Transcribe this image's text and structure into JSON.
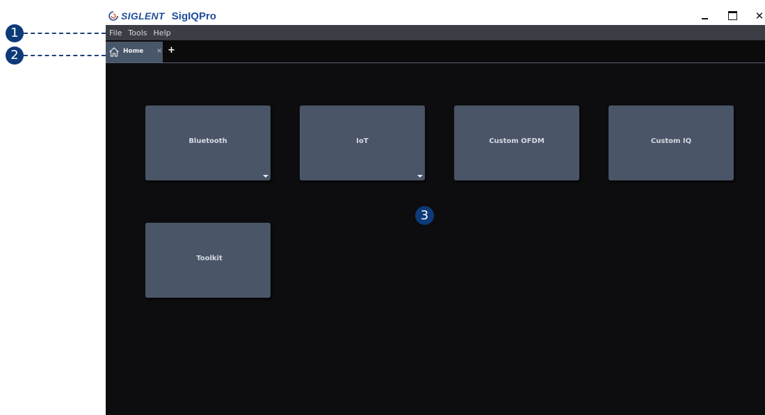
{
  "callouts": [
    "1",
    "2",
    "3"
  ],
  "app": {
    "brand": "SIGLENT",
    "title": "SigIQPro"
  },
  "window_controls": {
    "minimize": "_",
    "maximize": "☐",
    "close": "✕"
  },
  "menu": [
    "File",
    "Tools",
    "Help"
  ],
  "tabs": [
    {
      "label": "Home",
      "icon": "home-icon",
      "close": "×"
    }
  ],
  "tab_add": "+",
  "tiles": [
    {
      "label": "Bluetooth",
      "has_dropdown": true
    },
    {
      "label": "IoT",
      "has_dropdown": true
    },
    {
      "label": "Custom OFDM",
      "has_dropdown": false
    },
    {
      "label": "Custom IQ",
      "has_dropdown": false
    },
    {
      "label": "Toolkit",
      "has_dropdown": false
    }
  ],
  "colors": {
    "callout": "#0d3a78",
    "brand": "#1f4e9b",
    "tile": "#4a5567",
    "workspace": "#0d0d0f"
  }
}
